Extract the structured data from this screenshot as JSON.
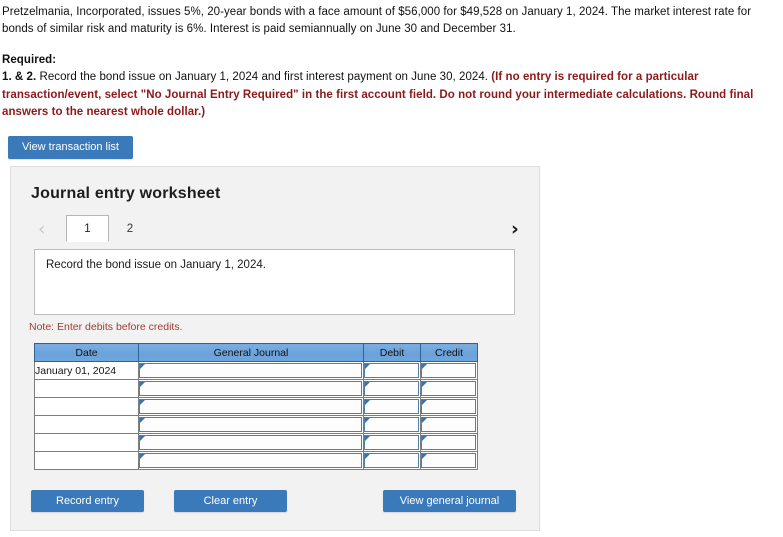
{
  "problem": {
    "paragraph": "Pretzelmania, Incorporated, issues 5%, 20-year bonds with a face amount of $56,000 for $49,528 on January 1, 2024. The market interest rate for bonds of similar risk and maturity is 6%. Interest is paid semiannually on June 30 and December 31.",
    "required_label": "Required:",
    "requirement_number": "1. & 2.",
    "requirement_text": " Record the bond issue on January 1, 2024 and first interest payment on June 30, 2024. ",
    "requirement_note": "(If no entry is required for a particular transaction/event, select \"No Journal Entry Required\" in the first account field. Do not round your intermediate calculations. Round final answers to the nearest whole dollar.)"
  },
  "toolbar": {
    "view_transaction_list": "View transaction list"
  },
  "worksheet": {
    "title": "Journal entry worksheet",
    "prev_arrow": "‹",
    "next_arrow": "›",
    "tabs": [
      {
        "label": "1",
        "active": true
      },
      {
        "label": "2",
        "active": false
      }
    ],
    "description": "Record the bond issue on January 1, 2024.",
    "note": "Note: Enter debits before credits.",
    "table": {
      "headers": [
        "Date",
        "General Journal",
        "Debit",
        "Credit"
      ],
      "rows": [
        {
          "date": "January 01, 2024",
          "general_journal": "",
          "debit": "",
          "credit": ""
        },
        {
          "date": "",
          "general_journal": "",
          "debit": "",
          "credit": ""
        },
        {
          "date": "",
          "general_journal": "",
          "debit": "",
          "credit": ""
        },
        {
          "date": "",
          "general_journal": "",
          "debit": "",
          "credit": ""
        },
        {
          "date": "",
          "general_journal": "",
          "debit": "",
          "credit": ""
        },
        {
          "date": "",
          "general_journal": "",
          "debit": "",
          "credit": ""
        }
      ]
    },
    "buttons": {
      "record_entry": "Record entry",
      "clear_entry": "Clear entry",
      "view_general_journal": "View general journal"
    }
  },
  "colors": {
    "button_blue": "#3a79ba",
    "table_header_blue": "#6ba2da",
    "alert_red": "#8d1a1a",
    "note_red": "#9c3b32",
    "panel_gray": "#f2f2f2"
  }
}
